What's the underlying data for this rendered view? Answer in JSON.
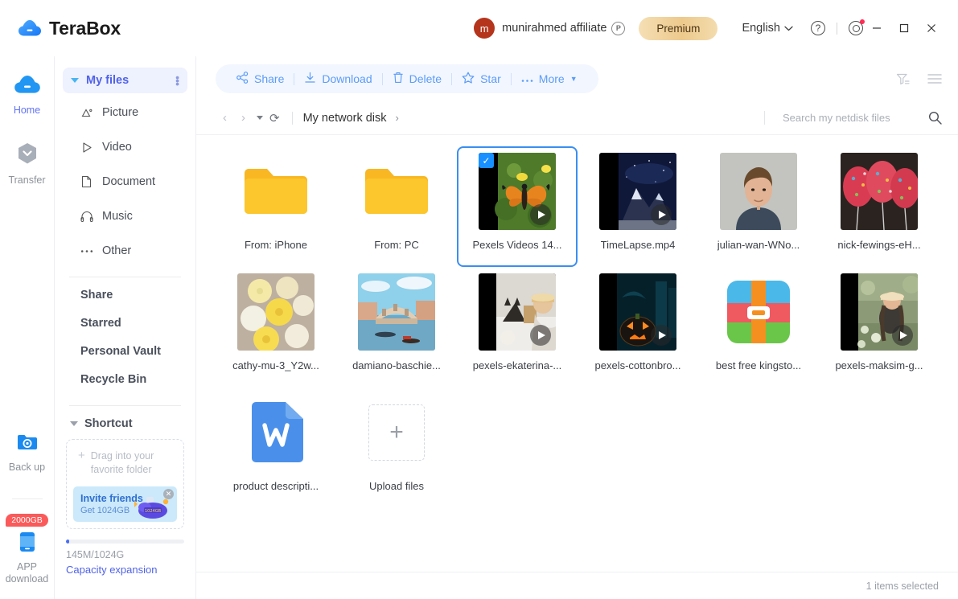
{
  "titlebar": {
    "brand": "TeraBox",
    "brand_logo_icon": "terabox-cloud-logo",
    "avatar_letter": "m",
    "username": "munirahmed affiliate",
    "p_badge": "P",
    "premium_label": "Premium",
    "language": "English",
    "help_icon": "question-circle-icon",
    "settings_icon": "gear-icon",
    "minimize_icon": "minimize-icon",
    "maximize_icon": "maximize-icon",
    "close_icon": "close-icon",
    "minimize_glyph": "—",
    "maximize_glyph": "☐",
    "close_glyph": "✕",
    "chevron_glyph": "∨",
    "help_glyph": "?"
  },
  "rail": {
    "items": [
      {
        "label": "Home",
        "icon": "home-cloud-icon",
        "active": true
      },
      {
        "label": "Transfer",
        "icon": "transfer-hexagon-icon",
        "active": false
      }
    ],
    "backup": {
      "label": "Back up",
      "icon": "backup-folder-icon"
    },
    "promo_badge": "2000GB",
    "app_download": {
      "label_line1": "APP",
      "label_line2": "download",
      "icon": "mobile-device-icon"
    }
  },
  "sidebar": {
    "my_files": {
      "label": "My files",
      "kebab_icon": "kebab-menu-icon",
      "caret_icon": "caret-down-icon"
    },
    "nav": [
      {
        "label": "Picture",
        "icon": "picture-icon",
        "glyph": "△"
      },
      {
        "label": "Video",
        "icon": "video-play-icon",
        "glyph": "▷"
      },
      {
        "label": "Document",
        "icon": "document-icon",
        "glyph": "✐"
      },
      {
        "label": "Music",
        "icon": "music-headphone-icon",
        "glyph": "∩"
      },
      {
        "label": "Other",
        "icon": "more-dots-icon",
        "glyph": "⋯"
      }
    ],
    "groups": [
      {
        "label": "Share"
      },
      {
        "label": "Starred"
      },
      {
        "label": "Personal Vault"
      },
      {
        "label": "Recycle Bin"
      }
    ],
    "shortcut": {
      "label": "Shortcut",
      "caret_icon": "caret-down-icon"
    },
    "drag_hint_line1": "Drag into your",
    "drag_hint_line2": "favorite folder",
    "drag_plus": "+",
    "invite": {
      "title": "Invite friends",
      "subtitle": "Get 1024GB",
      "art_label": "1024GB",
      "close_icon": "close-icon",
      "close_glyph": "✕"
    },
    "capacity": {
      "used_text": "145M/1024G",
      "link": "Capacity expansion",
      "percent": 0.8
    }
  },
  "toolbar": {
    "buttons": [
      {
        "label": "Share",
        "icon": "share-nodes-icon"
      },
      {
        "label": "Download",
        "icon": "download-icon"
      },
      {
        "label": "Delete",
        "icon": "trash-icon"
      },
      {
        "label": "Star",
        "icon": "star-icon"
      },
      {
        "label": "More",
        "icon": "more-dots-icon"
      }
    ],
    "more_caret": "▼",
    "sort_icon": "sort-filter-icon",
    "view_icon": "list-view-icon"
  },
  "breadcrumb": {
    "back_icon": "chevron-left-icon",
    "forward_icon": "chevron-right-icon",
    "back_glyph": "‹",
    "forward_glyph": "›",
    "history_caret_icon": "caret-down-icon",
    "refresh_icon": "refresh-icon",
    "refresh_glyph": "⟳",
    "path": "My network disk",
    "path_sep": "›"
  },
  "search": {
    "placeholder": "Search my netdisk files",
    "value": "",
    "icon": "search-icon"
  },
  "files": {
    "rows": [
      [
        {
          "name": "From: iPhone",
          "type": "folder",
          "selected": false,
          "video": false
        },
        {
          "name": "From:  PC",
          "type": "folder",
          "selected": false,
          "video": false
        },
        {
          "name": "Pexels Videos 14...",
          "type": "video",
          "selected": true,
          "video": true,
          "thumb": "butterfly"
        },
        {
          "name": "TimeLapse.mp4",
          "type": "video",
          "selected": false,
          "video": true,
          "thumb": "mountain"
        },
        {
          "name": "julian-wan-WNo...",
          "type": "image",
          "selected": false,
          "video": false,
          "thumb": "portrait"
        },
        {
          "name": "nick-fewings-eH...",
          "type": "image",
          "selected": false,
          "video": false,
          "thumb": "balloons"
        }
      ],
      [
        {
          "name": "cathy-mu-3_Y2w...",
          "type": "image",
          "selected": false,
          "video": false,
          "thumb": "flowers"
        },
        {
          "name": "damiano-baschie...",
          "type": "image",
          "selected": false,
          "video": false,
          "thumb": "venice"
        },
        {
          "name": "pexels-ekaterina-...",
          "type": "video",
          "selected": false,
          "video": true,
          "thumb": "cat-bed"
        },
        {
          "name": "pexels-cottonbro...",
          "type": "video",
          "selected": false,
          "video": true,
          "thumb": "pumpkin"
        },
        {
          "name": "best free kingsto...",
          "type": "archive",
          "selected": false,
          "video": false,
          "thumb": "winrar"
        },
        {
          "name": "pexels-maksim-g...",
          "type": "video",
          "selected": false,
          "video": true,
          "thumb": "field-woman"
        }
      ],
      [
        {
          "name": "product descripti...",
          "type": "doc",
          "selected": false,
          "video": false,
          "thumb": "word"
        },
        {
          "name": "Upload files",
          "type": "upload",
          "selected": false,
          "video": false
        }
      ]
    ]
  },
  "statusbar": {
    "selection": "1 items selected"
  },
  "colors": {
    "accent_blue": "#5063e8",
    "toolbar_blue": "#5b9cf8",
    "select_blue": "#3a8ef0",
    "premium_gold": "#edc98c",
    "avatar_red": "#b5341c",
    "badge_red": "#fa5a5a"
  }
}
